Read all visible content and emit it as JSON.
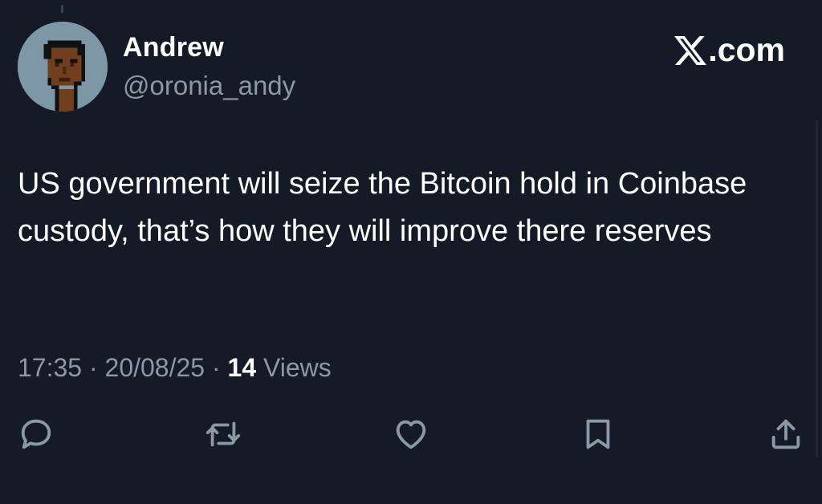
{
  "author": {
    "display_name": "Andrew",
    "handle": "@oronia_andy",
    "avatar_icon": "pixel-punk-avatar"
  },
  "brand": {
    "logo_icon": "x-logo-icon",
    "domain_text": ".com"
  },
  "tweet": {
    "text": "US government will seize the Bitcoin hold in Coinbase custody, that’s how they will improve there reserves"
  },
  "meta": {
    "time": "17:35",
    "separator_1": " · ",
    "date": "20/08/25",
    "separator_2": " · ",
    "views_count": "14",
    "views_label": " Views"
  },
  "actions": [
    {
      "name": "reply",
      "icon": "reply-icon"
    },
    {
      "name": "retweet",
      "icon": "retweet-icon"
    },
    {
      "name": "like",
      "icon": "heart-icon"
    },
    {
      "name": "bookmark",
      "icon": "bookmark-icon"
    },
    {
      "name": "share",
      "icon": "share-icon"
    }
  ],
  "colors": {
    "background": "#151b26",
    "primary_text": "#ffffff",
    "secondary_text": "#8b98a5",
    "icon": "#8b98a5"
  }
}
